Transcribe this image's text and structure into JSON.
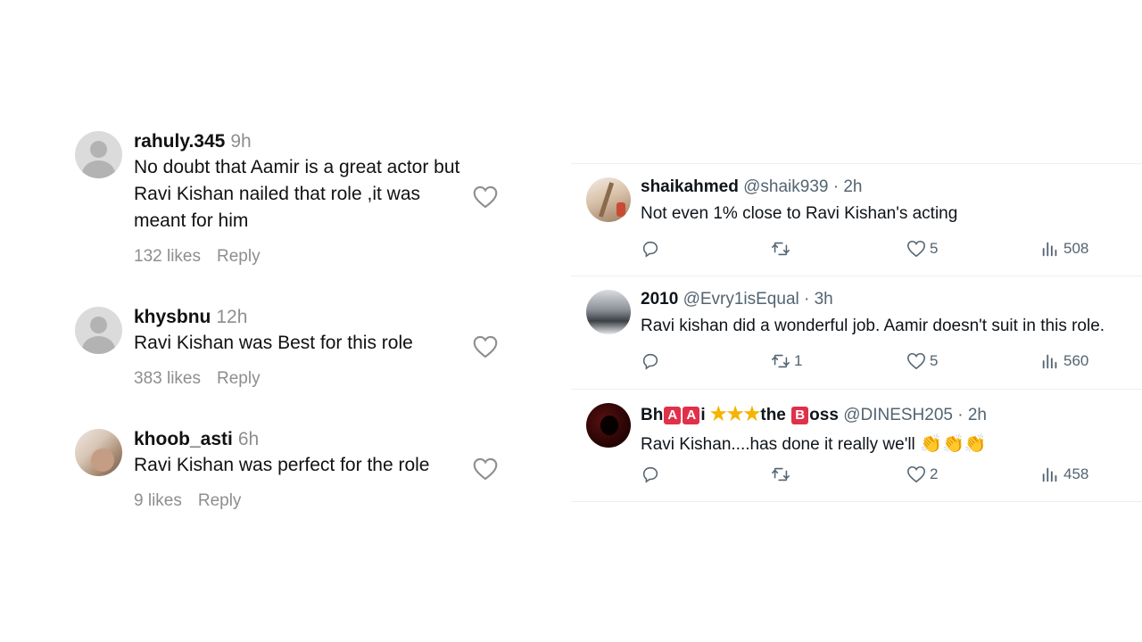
{
  "instagram_comments": [
    {
      "username": "rahuly.345",
      "time": "9h",
      "text": "No doubt that Aamir is a great actor but Ravi Kishan nailed that role ,it was meant for him",
      "likes": "132 likes",
      "reply": "Reply",
      "avatar_icon": "default-avatar-icon"
    },
    {
      "username": "khysbnu",
      "time": "12h",
      "text": "Ravi Kishan was Best for this role",
      "likes": "383 likes",
      "reply": "Reply",
      "avatar_icon": "default-avatar-icon"
    },
    {
      "username": "khoob_asti",
      "time": "6h",
      "text": "Ravi Kishan was perfect for the role",
      "likes": "9 likes",
      "reply": "Reply",
      "avatar_icon": "photo-avatar"
    }
  ],
  "tweets": [
    {
      "name": "shaikahmed",
      "handle": "@shaik939 · 2h",
      "text": "Not even 1% close to Ravi Kishan's acting",
      "replies": "",
      "retweets": "",
      "likes": "5",
      "views": "508"
    },
    {
      "name": "2010",
      "handle": "@Evry1isEqual · 3h",
      "text": "Ravi kishan did a wonderful job. Aamir doesn't suit in this role.",
      "replies": "",
      "retweets": "1",
      "likes": "5",
      "views": "560"
    },
    {
      "name_parts": {
        "p1": "Bh",
        "b1": "A",
        "b2": "A",
        "p2": "i",
        "stars": "★★★",
        "p3": "the",
        "b3": "B",
        "p4": "oss"
      },
      "handle": "@DINESH205 · 2h",
      "text": "Ravi Kishan....has done it really we'll",
      "emoji": "👏👏👏",
      "replies": "",
      "retweets": "",
      "likes": "2",
      "views": "458"
    }
  ],
  "colors": {
    "text": "#111111",
    "muted": "#8e8e8e",
    "twitter_muted": "#536471",
    "badge_red": "#e0304a",
    "star_yellow": "#f5b400"
  }
}
